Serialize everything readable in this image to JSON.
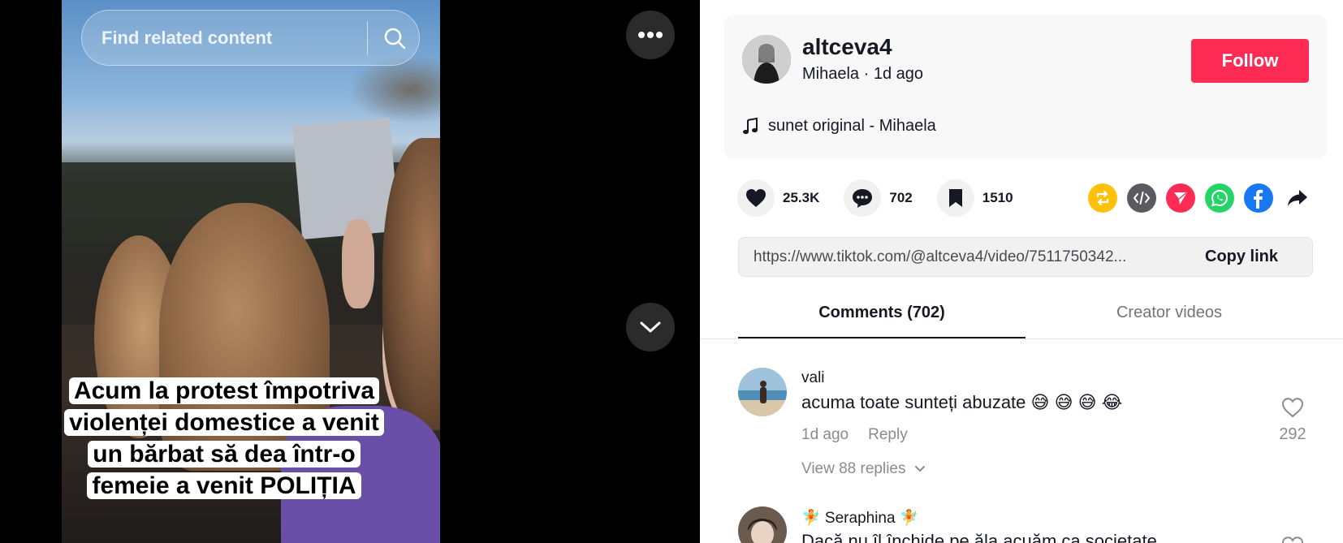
{
  "video": {
    "search_placeholder": "Find related content",
    "caption": "Acum la protest împotriva violenței domestice a venit un bărbat să dea într-o femeie a venit POLIȚIA"
  },
  "creator": {
    "username": "altceva4",
    "nickname": "Mihaela",
    "posted": "1d ago",
    "follow_label": "Follow",
    "music": "sunet original - Mihaela"
  },
  "actions": {
    "likes": "25.3K",
    "comments": "702",
    "saves": "1510"
  },
  "share_icons": [
    "repost-icon",
    "embed-icon",
    "send-icon",
    "whatsapp-icon",
    "facebook-icon",
    "share-arrow-icon"
  ],
  "colors": {
    "follow": "#fe2c55",
    "repost": "#ffc107",
    "embed": "#5a5a60",
    "send": "#fe2c55",
    "whatsapp": "#25d366",
    "facebook": "#1877f2"
  },
  "link": {
    "url": "https://www.tiktok.com/@altceva4/video/7511750342...",
    "copy_label": "Copy link"
  },
  "tabs": [
    {
      "label": "Comments (702)",
      "active": true
    },
    {
      "label": "Creator videos",
      "active": false
    }
  ],
  "comments": [
    {
      "user": "vali",
      "text": "acuma toate sunteți abuzate 😅 😅 😅 😂",
      "time": "1d ago",
      "reply_label": "Reply",
      "likes": "292",
      "replies_label": "View 88 replies"
    },
    {
      "user": "🧚 Seraphina 🧚",
      "text": "Dacă nu îl închide pe ăla acuăm ca societate"
    }
  ]
}
